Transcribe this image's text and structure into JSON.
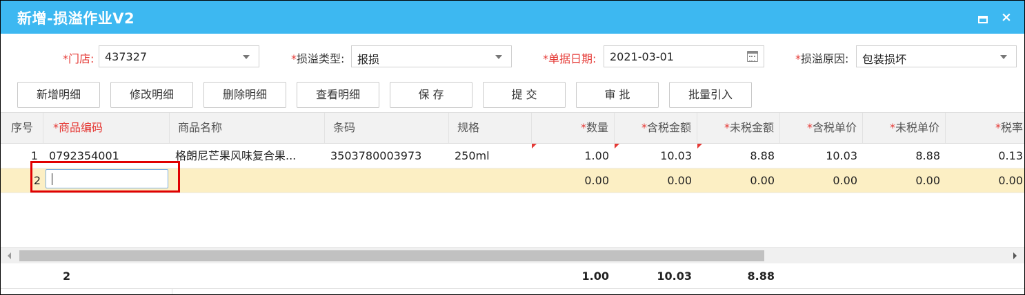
{
  "window": {
    "title": "新增-损溢作业V2",
    "maximize_icon": "maximize-icon",
    "close_icon": "close-icon",
    "close_glyph": "×",
    "accent_color": "#3db8f1"
  },
  "form": {
    "store": {
      "label": "门店:",
      "required_mark": "*",
      "value": "437327"
    },
    "adjust_type": {
      "label": "损溢类型:",
      "required_mark": "*",
      "value": "报损"
    },
    "doc_date": {
      "label": "单据日期:",
      "required_mark": "*",
      "value": "2021-03-01"
    },
    "reason": {
      "label": "损溢原因:",
      "required_mark": "*",
      "value": "包装损坏"
    }
  },
  "toolbar": {
    "add_detail": "新增明细",
    "edit_detail": "修改明细",
    "delete_detail": "删除明细",
    "view_detail": "查看明细",
    "save": "保 存",
    "submit": "提 交",
    "approve": "审 批",
    "batch_import": "批量引入"
  },
  "grid": {
    "columns": {
      "seq": "序号",
      "code": "*商品编码",
      "name": "商品名称",
      "barcode": "条码",
      "spec": "规格",
      "qty": "数量",
      "amount_tax": "含税金额",
      "amount_notax": "未税金额",
      "price_tax": "含税单价",
      "price_notax": "未税单价",
      "tax_rate": "税率",
      "required_mark": "*"
    },
    "rows": [
      {
        "seq": "1",
        "code": "0792354001",
        "name": "格朗尼芒果风味复合果...",
        "barcode": "3503780003973",
        "spec": "250ml",
        "qty": "1.00",
        "amount_tax": "10.03",
        "amount_notax": "8.88",
        "price_tax": "10.03",
        "price_notax": "8.88",
        "tax_rate": "0.13"
      },
      {
        "seq": "2",
        "code": "",
        "name": "",
        "barcode": "",
        "spec": "",
        "qty": "0.00",
        "amount_tax": "0.00",
        "amount_notax": "0.00",
        "price_tax": "0.00",
        "price_notax": "0.00",
        "tax_rate": "0.00"
      }
    ],
    "edit_row_color": "#fcefc4",
    "highlight_color": "#e00000"
  },
  "footer": {
    "count": "2",
    "qty_total": "1.00",
    "amount_tax_total": "10.03",
    "amount_notax_total": "8.88"
  }
}
